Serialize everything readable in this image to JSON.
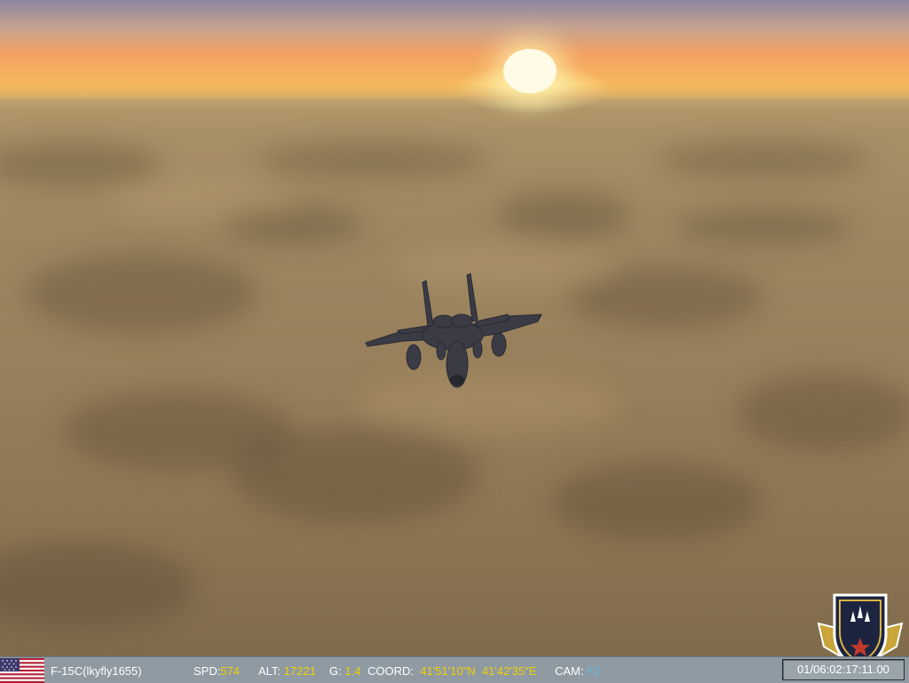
{
  "hud": {
    "player": "F-15C(lkyfly1655)",
    "spd_label": "SPD:",
    "spd_value": "574",
    "alt_label": "ALT:",
    "alt_value": "17221",
    "g_label": "G:",
    "g_value": "1.4",
    "coord_label": "COORD:",
    "lat": "41'51'10\"N",
    "lon": "41'42'35\"E",
    "cam_label": "CAM:",
    "cam_value": "F2",
    "clock": "01/06:02:17:11.00"
  },
  "icons": {
    "flag": "usa-flag-icon",
    "emblem": "squadron-emblem"
  },
  "colors": {
    "hud_bar": "#8f9aa2",
    "value_yellow": "#f0d000",
    "cam_blue": "#63b8e8",
    "sun": "#fffbe6",
    "sky_orange": "#f2a163",
    "cloud_tan": "#9d8660"
  }
}
